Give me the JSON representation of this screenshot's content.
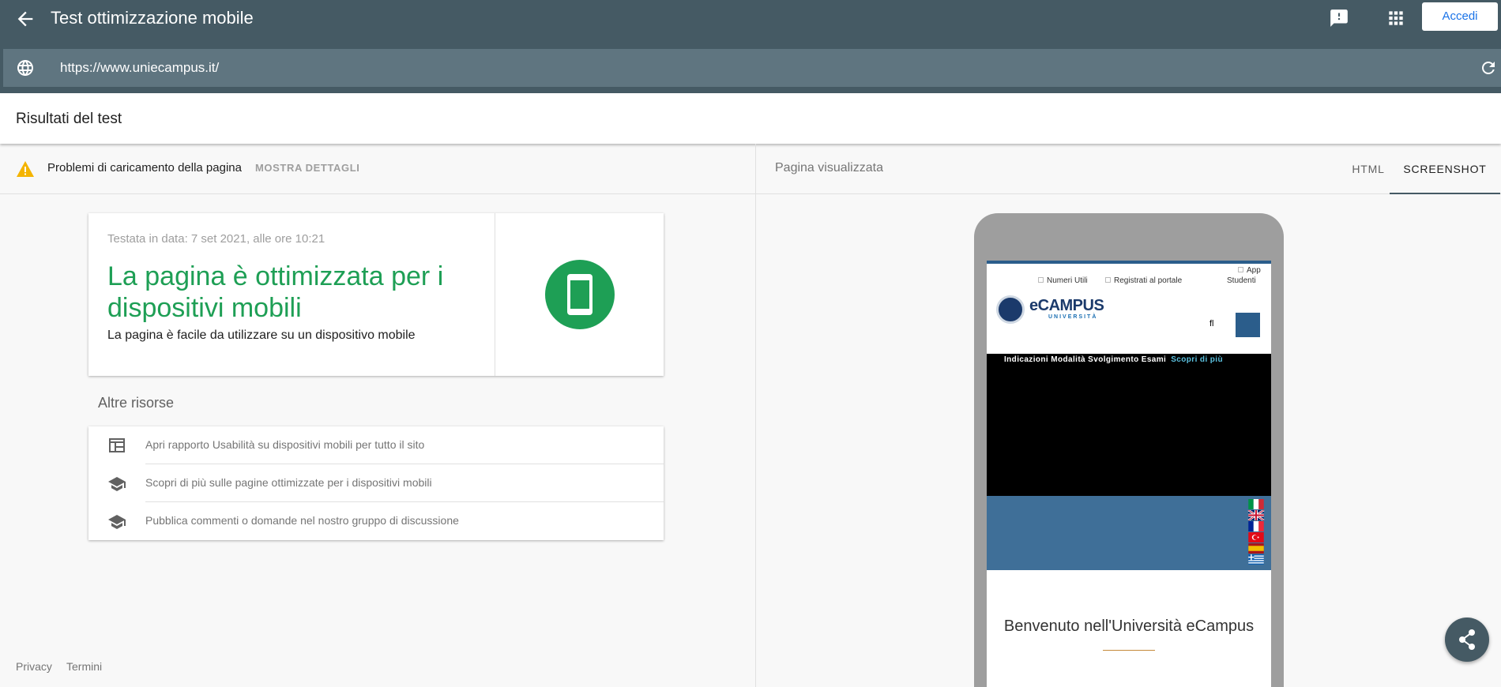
{
  "appbar": {
    "title": "Test ottimizzazione mobile",
    "back_icon": "arrow-back-icon",
    "feedback_icon": "feedback-icon",
    "apps_icon": "apps-grid-icon",
    "signin_label": "Accedi"
  },
  "urlbar": {
    "globe_icon": "globe-icon",
    "url": "https://www.uniecampus.it/",
    "reload_icon": "reload-icon"
  },
  "results": {
    "title": "Risultati del test"
  },
  "left": {
    "warning_icon": "warning-icon",
    "warning_text": "Problemi di caricamento della pagina",
    "details_label": "MOSTRA DETTAGLI",
    "card": {
      "date": "Testata in data: 7 set 2021, alle ore 10:21",
      "verdict": "La pagina è ottimizzata per i dispositivi mobili",
      "subtitle": "La pagina è facile da utilizzare su un dispositivo mobile",
      "badge_icon": "smartphone-icon"
    },
    "resources_title": "Altre risorse",
    "resources": [
      {
        "icon": "web-icon",
        "label": "Apri rapporto Usabilità su dispositivi mobili per tutto il sito"
      },
      {
        "icon": "school-icon",
        "label": "Scopri di più sulle pagine ottimizzate per i dispositivi mobili"
      },
      {
        "icon": "school-icon",
        "label": "Pubblica commenti o domande nel nostro gruppo di discussione"
      }
    ],
    "footer": {
      "privacy": "Privacy",
      "terms": "Termini"
    }
  },
  "right": {
    "label": "Pagina visualizzata",
    "tabs": [
      {
        "label": "HTML",
        "active": false
      },
      {
        "label": "SCREENSHOT",
        "active": true
      }
    ],
    "screenshot": {
      "app": "App",
      "students": "Studenti",
      "numeri_utili": "Numeri Utili",
      "registrati": "Registrati al portale",
      "logo_text": "eCAMPUS",
      "logo_sub": "UNIVERSITÀ",
      "search_glyph": "fl",
      "banner_text": "Indicazioni Modalità Svolgimento Esami",
      "banner_link": "Scopri di più",
      "welcome": "Benvenuto nell'Università eCampus"
    }
  },
  "share_icon": "share-icon",
  "colors": {
    "appbar": "#455a64",
    "urlbar": "#5f7580",
    "success": "#1e9f55",
    "warning": "#f4b400",
    "accent": "#1a73e8"
  }
}
